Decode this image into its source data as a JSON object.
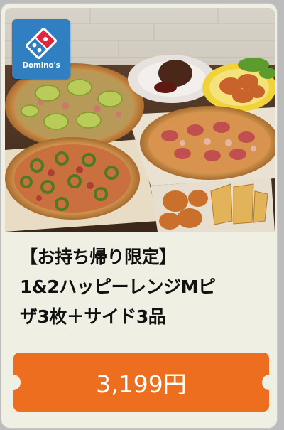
{
  "brand": {
    "logo_text": "Domino's",
    "colors": {
      "blue": "#2f7fc1",
      "red": "#e3263e",
      "white": "#ffffff"
    }
  },
  "coupon": {
    "image_description_icon": "food-photo",
    "title_lines": [
      "【お持ち帰り限定】",
      "1&2ハッピーレンジMピ",
      "ザ3枚＋サイド3品"
    ],
    "price_label": "3,199円",
    "accent_color": "#ed6e1f"
  }
}
